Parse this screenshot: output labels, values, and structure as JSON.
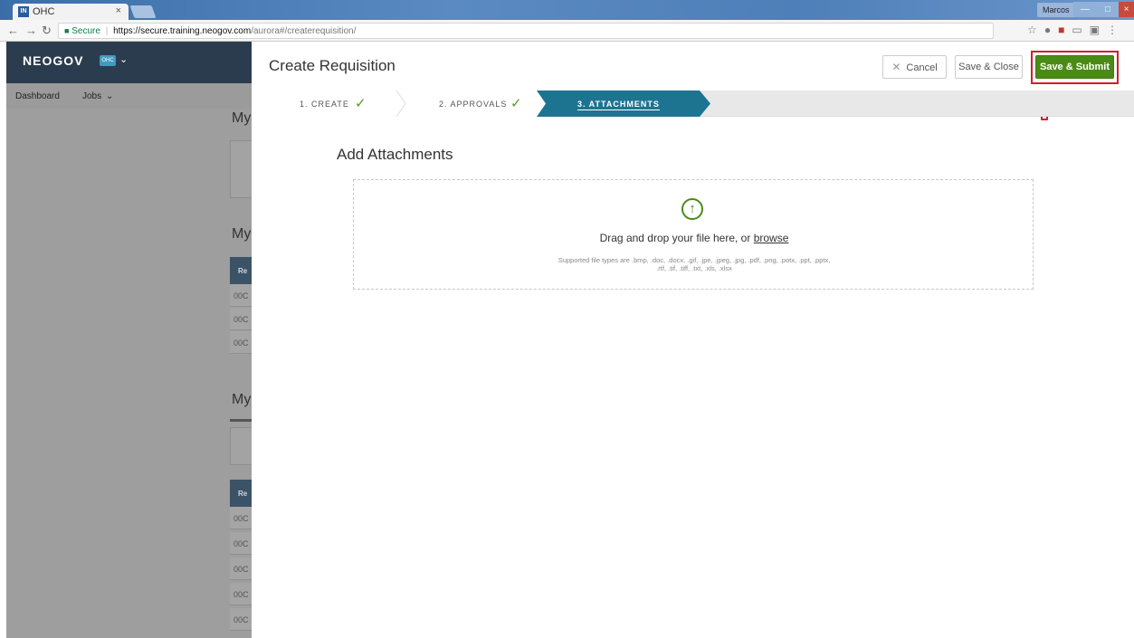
{
  "browser": {
    "tab_title": "OHC",
    "tab_close": "×",
    "favicon_text": "IN",
    "profile_name": "Marcos",
    "secure_label": "Secure",
    "url_host": "https://secure.training.neogov.com",
    "url_path": "/aurora#/createrequisition/"
  },
  "background_app": {
    "brand": "NEOGOV",
    "badge": "OHC",
    "nav": [
      "Dashboard",
      "Jobs"
    ],
    "section_titles": [
      "My",
      "My",
      "My"
    ],
    "table_header": "Re",
    "row_text": "00C"
  },
  "panel": {
    "title": "Create Requisition",
    "cancel_label": "Cancel",
    "save_close_label": "Save & Close",
    "submit_label": "Save & Submit",
    "steps": [
      {
        "label": "1. CREATE",
        "done": true
      },
      {
        "label": "2. APPROVALS",
        "done": true
      },
      {
        "label": "3. ATTACHMENTS",
        "active": true
      }
    ],
    "section_title": "Add Attachments",
    "drop_text": "Drag and drop your file here, or",
    "browse_label": "browse",
    "supported_text": "Supported file types are .bmp, .doc, .docx, .gif, .jpe, .jpeg, .jpg, .pdf, .png, .potx, .ppt, .pptx, .rtf, .tif, .tiff, .txt, .xls, .xlsx"
  },
  "colors": {
    "accent_green": "#4a8b16",
    "step_active": "#1d7491",
    "annotation_red": "#d0202a",
    "header_dark": "#2b3c4e"
  }
}
